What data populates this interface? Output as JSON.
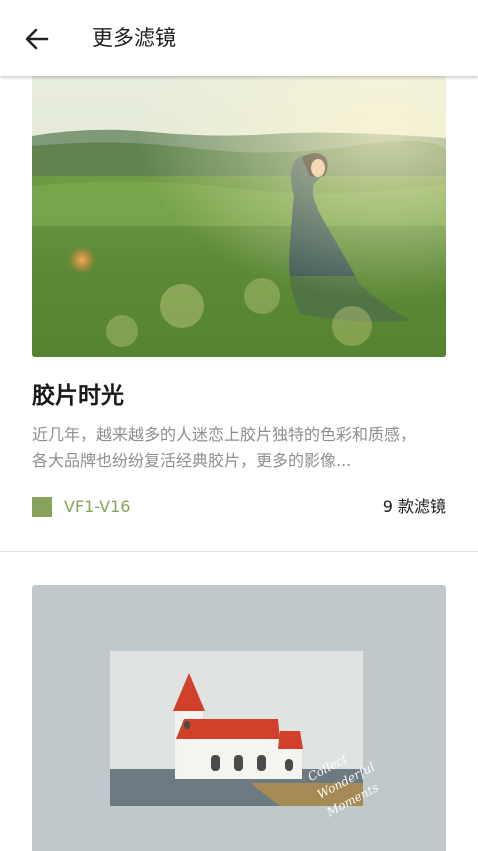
{
  "appbar": {
    "title": "更多滤镜",
    "back_icon": "arrow-left-icon"
  },
  "cards": [
    {
      "title": "胶片时光",
      "description": "近几年，越来越多的人迷恋上胶片独特的色彩和质感，各大品牌也纷纷复活经典胶片，更多的影像...",
      "code": "VF1-V16",
      "count": "9 款滤镜",
      "accent_color": "#8aa35a",
      "image": "woman-in-meadow-photo"
    },
    {
      "image": "church-on-grey-photo",
      "watermark_text": "Collect Wonderful Moments"
    }
  ]
}
